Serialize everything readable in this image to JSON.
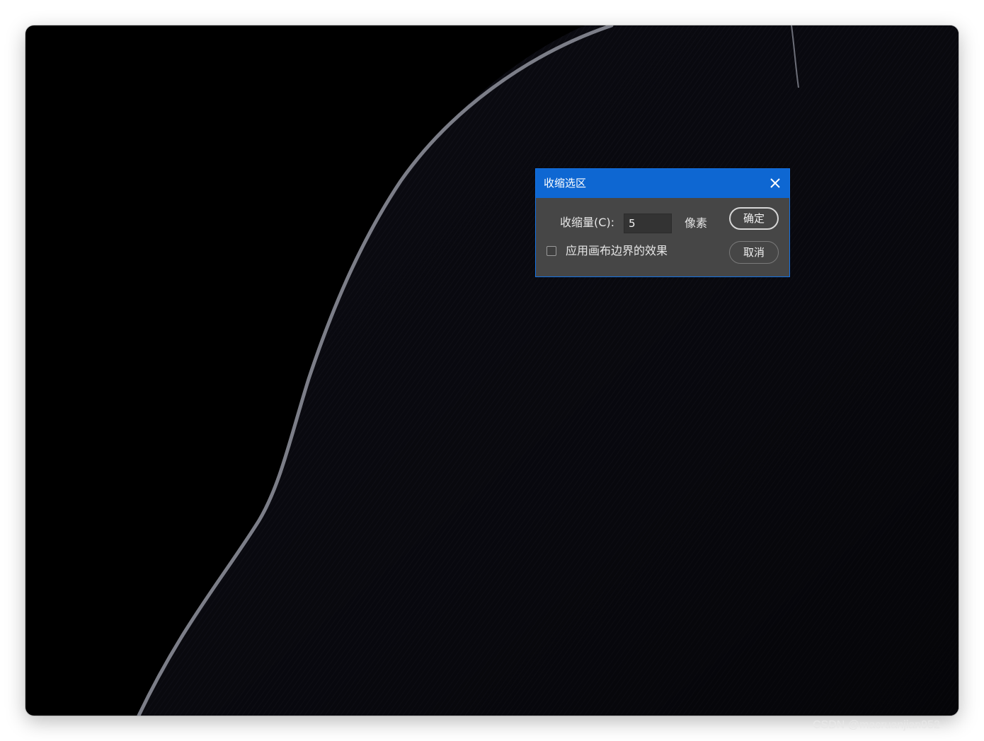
{
  "dialog": {
    "title": "收缩选区",
    "amount_label": "收缩量(C):",
    "amount_value": "5",
    "unit": "像素",
    "checkbox_label": "应用画布边界的效果",
    "checkbox_checked": false,
    "ok_label": "确定",
    "cancel_label": "取消"
  },
  "watermark": "CSDN @macruanjian952",
  "colors": {
    "titlebar": "#0e67d2",
    "dialog_bg": "#464646",
    "canvas_bg": "#000000",
    "shape_fill": "#0a0a10",
    "selection_edge": "#7c7e88"
  },
  "icons": {
    "close": "close-icon"
  }
}
